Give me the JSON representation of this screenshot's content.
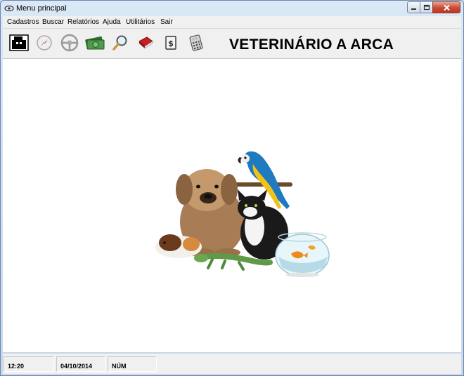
{
  "window": {
    "title": "Menu principal"
  },
  "menu": [
    "Cadastros",
    "Buscar",
    "Relatórios",
    "Ajuda",
    "Utilitários",
    "Sair"
  ],
  "toolbar": {
    "buttons": [
      "cash-register-icon",
      "compass-icon",
      "steering-wheel-icon",
      "money-icon",
      "magnifier-icon",
      "book-icon",
      "dollar-card-icon",
      "calculator-icon"
    ]
  },
  "header": {
    "title": "VETERINÁRIO A ARCA"
  },
  "status": {
    "time": "12:20",
    "date": "04/10/2014",
    "num": "NÚM"
  }
}
